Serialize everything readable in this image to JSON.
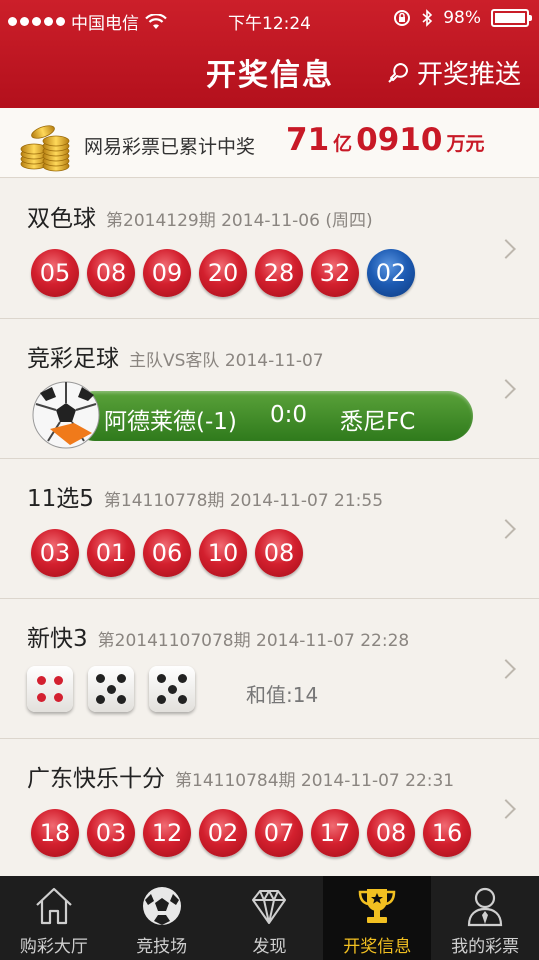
{
  "status_bar": {
    "carrier": "中国电信",
    "time": "下午12:24",
    "battery": "98%"
  },
  "header": {
    "title": "开奖信息",
    "push_label": "开奖推送"
  },
  "banner": {
    "text": "网易彩票已累计中奖",
    "amount_yi": "71",
    "unit_yi": "亿",
    "amount_wan": "0910",
    "unit_wan": "万元"
  },
  "lotteries": [
    {
      "name": "双色球",
      "info": "第2014129期  2014-11-06 (周四)",
      "red_balls": [
        "05",
        "08",
        "09",
        "20",
        "28",
        "32"
      ],
      "blue_balls": [
        "02"
      ]
    },
    {
      "name": "竞彩足球",
      "info": "主队VS客队  2014-11-07",
      "home": "阿德莱德(-1)",
      "score": "0:0",
      "away": "悉尼FC"
    },
    {
      "name": "11选5",
      "info": "第14110778期  2014-11-07 21:55",
      "red_balls": [
        "03",
        "01",
        "06",
        "10",
        "08"
      ]
    },
    {
      "name": "新快3",
      "info": "第20141107078期  2014-11-07 22:28",
      "dice": [
        4,
        5,
        5
      ],
      "sum_label": "和值:14"
    },
    {
      "name": "广东快乐十分",
      "info": "第14110784期  2014-11-07 22:31",
      "red_balls": [
        "18",
        "03",
        "12",
        "02",
        "07",
        "17",
        "08",
        "16"
      ]
    }
  ],
  "tabs": [
    {
      "label": "购彩大厅",
      "icon": "house-icon"
    },
    {
      "label": "竞技场",
      "icon": "soccer-ball-icon"
    },
    {
      "label": "发现",
      "icon": "diamond-icon"
    },
    {
      "label": "开奖信息",
      "icon": "trophy-icon"
    },
    {
      "label": "我的彩票",
      "icon": "person-icon"
    }
  ],
  "colors": {
    "brand_red": "#c81926",
    "active_tab": "#f2c021",
    "blue_ball": "#1d5bb3"
  }
}
